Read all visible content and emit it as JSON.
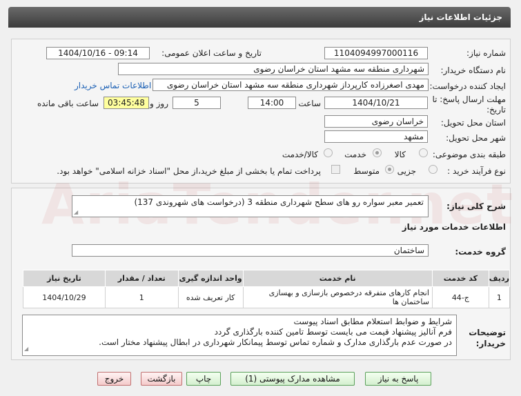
{
  "title": "جزئیات اطلاعات نیاز",
  "watermark": "AriaTender.net",
  "form": {
    "need_number_label": "شماره نیاز:",
    "need_number": "1104094997000116",
    "announce_label": "تاریخ و ساعت اعلان عمومی:",
    "announce_value": "1404/10/16 - 09:14",
    "buyer_label": "نام دستگاه خریدار:",
    "buyer": "شهرداری منطقه سه مشهد استان خراسان رضوی",
    "creator_label": "ایجاد کننده درخواست:",
    "creator": "مهدی اصغرزاده کارپرداز شهرداری منطقه سه مشهد استان خراسان رضوی",
    "contact_link": "اطلاعات تماس خریدار",
    "deadline_label": "مهلت ارسال پاسخ: تا تاریخ:",
    "deadline_date": "1404/10/21",
    "time_label": "ساعت",
    "deadline_time": "14:00",
    "days_value": "5",
    "days_label": "روز و",
    "remaining_time": "03:45:48",
    "remaining_label": "ساعت باقی مانده",
    "province_label": "استان محل تحویل:",
    "province": "خراسان رضوی",
    "city_label": "شهر محل تحویل:",
    "city": "مشهد",
    "category_label": "طبقه بندی موضوعی:",
    "category_options": [
      "کالا",
      "خدمت",
      "کالا/خدمت"
    ],
    "category_selected": "خدمت",
    "process_label": "نوع فرآیند خرید :",
    "process_options": [
      "جزیی",
      "متوسط"
    ],
    "process_selected": "متوسط",
    "payment_text": "پرداخت تمام یا بخشی از مبلغ خرید،از محل \"اسناد خزانه اسلامی\" خواهد بود."
  },
  "summary": {
    "label": "شرح کلی نیاز:",
    "text": "تعمیر معبر سواره رو های سطح شهرداری منطقه 3 (درخواست های شهروندی 137)"
  },
  "services": {
    "heading": "اطلاعات خدمات مورد نیاز",
    "group_label": "گروه خدمت:",
    "group_value": "ساختمان",
    "columns": [
      "ردیف",
      "کد خدمت",
      "نام خدمت",
      "واحد اندازه گیری",
      "تعداد / مقدار",
      "تاریخ نیاز"
    ],
    "rows": [
      [
        "1",
        "ج-44",
        "انجام کارهای متفرقه درخصوص بازسازی و بهسازی ساختمان ها",
        "کار تعریف شده",
        "1",
        "1404/10/29"
      ]
    ]
  },
  "buyer_notes": {
    "label": "توضیحات خریدار:",
    "lines": [
      "شرایط و ضوابط استعلام مطابق اسناد پیوست",
      "فرم آنالیز پیشنهاد قیمت می بایست توسط تامین کننده بارگذاری گردد",
      "در صورت عدم بارگذاری مدارک و شماره تماس توسط پیمانکار شهرداری در ابطال پیشنهاد مختار است."
    ]
  },
  "buttons": {
    "reply": "پاسخ به نیاز",
    "attachments": "مشاهده مدارک پیوستی (1)",
    "print": "چاپ",
    "back": "بازگشت",
    "exit": "خروج"
  }
}
